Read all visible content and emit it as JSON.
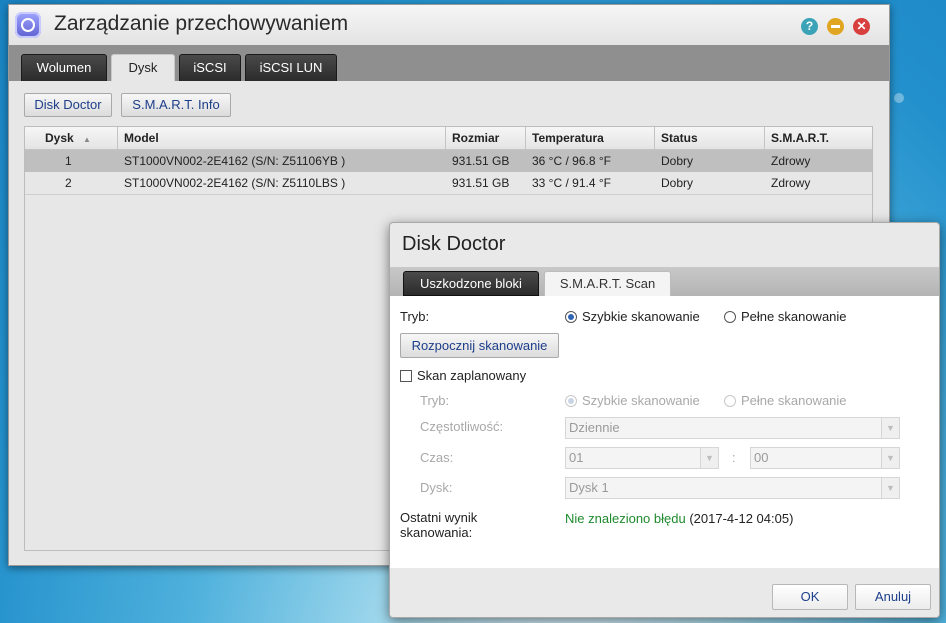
{
  "window": {
    "title": "Zarządzanie przechowywaniem",
    "controls": {
      "help": "?",
      "minimize": "",
      "close": "✕"
    },
    "tabs": [
      {
        "label": "Wolumen",
        "active": false
      },
      {
        "label": "Dysk",
        "active": true
      },
      {
        "label": "iSCSI",
        "active": false
      },
      {
        "label": "iSCSI LUN",
        "active": false
      }
    ],
    "toolbar": {
      "disk_doctor": "Disk Doctor",
      "smart_info": "S.M.A.R.T. Info"
    },
    "table": {
      "columns": [
        "Dysk",
        "Model",
        "Rozmiar",
        "Temperatura",
        "Status",
        "S.M.A.R.T."
      ],
      "sort_indicator": "▲",
      "rows": [
        {
          "disk": "1",
          "model": "ST1000VN002-2E4162 (S/N: Z51106YB )",
          "size": "931.51 GB",
          "temp": "36 °C / 96.8 °F",
          "status": "Dobry",
          "smart": "Zdrowy",
          "selected": true
        },
        {
          "disk": "2",
          "model": "ST1000VN002-2E4162 (S/N: Z5110LBS )",
          "size": "931.51 GB",
          "temp": "33 °C / 91.4 °F",
          "status": "Dobry",
          "smart": "Zdrowy",
          "selected": false
        }
      ]
    }
  },
  "dialog": {
    "title": "Disk Doctor",
    "tabs": [
      "Uszkodzone bloki",
      "S.M.A.R.T. Scan"
    ],
    "mode_label": "Tryb:",
    "mode_quick": "Szybkie skanowanie",
    "mode_full": "Pełne skanowanie",
    "start_button": "Rozpocznij skanowanie",
    "scheduled_label": "Skan zaplanowany",
    "scheduled_checked": false,
    "sched": {
      "mode_label": "Tryb:",
      "mode_quick": "Szybkie skanowanie",
      "mode_full": "Pełne skanowanie",
      "frequency_label": "Częstotliwość:",
      "frequency_value": "Dziennie",
      "time_label": "Czas:",
      "hour_value": "01",
      "time_sep": ":",
      "minute_value": "00",
      "disk_label": "Dysk:",
      "disk_value": "Dysk 1"
    },
    "result_label_1": "Ostatni wynik",
    "result_label_2": "skanowania:",
    "result_status": "Nie znaleziono błędu",
    "result_time": "(2017-4-12 04:05)",
    "ok": "OK",
    "cancel": "Anuluj"
  },
  "colors": {
    "accent": "#1d3e8a",
    "success": "#1f8a2e",
    "selected_row": "#bfbfbf"
  }
}
